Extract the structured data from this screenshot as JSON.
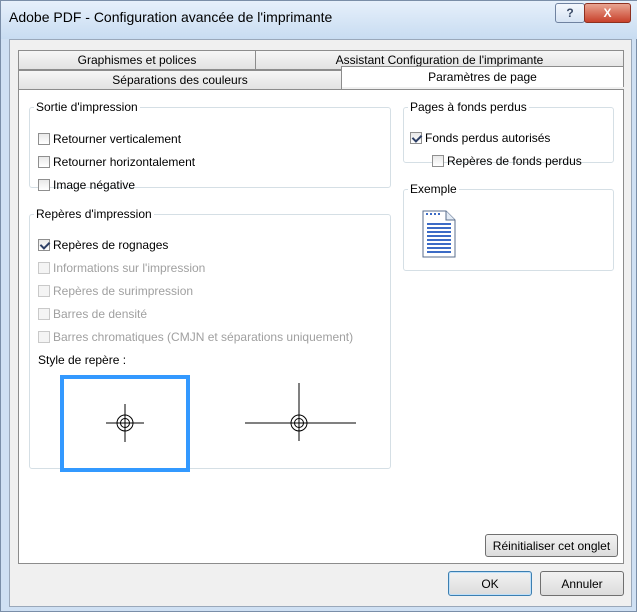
{
  "window": {
    "title": "Adobe PDF - Configuration avancée de l'imprimante",
    "help_glyph": "?",
    "close_glyph": "X"
  },
  "tabs": {
    "row1": [
      "Graphismes et polices",
      "Assistant Configuration de l'imprimante"
    ],
    "row2": [
      "Séparations des couleurs",
      "Paramètres de page"
    ],
    "active": "Paramètres de page"
  },
  "sortie": {
    "legend": "Sortie d'impression",
    "items": [
      {
        "label": "Retourner verticalement",
        "checked": false,
        "enabled": true
      },
      {
        "label": "Retourner horizontalement",
        "checked": false,
        "enabled": true
      },
      {
        "label": "Image négative",
        "checked": false,
        "enabled": true
      }
    ]
  },
  "reperes": {
    "legend": "Repères d'impression",
    "items": [
      {
        "label": "Repères de rognages",
        "checked": true,
        "enabled": true
      },
      {
        "label": "Informations sur l'impression",
        "checked": false,
        "enabled": false
      },
      {
        "label": "Repères de surimpression",
        "checked": false,
        "enabled": false
      },
      {
        "label": "Barres de densité",
        "checked": false,
        "enabled": false
      },
      {
        "label": "Barres chromatiques (CMJN et séparations uniquement)",
        "checked": false,
        "enabled": false
      }
    ],
    "style_label": "Style de repère :",
    "styles": [
      "compact",
      "long"
    ],
    "selected_style": "compact"
  },
  "fonds_perdus": {
    "legend": "Pages à fonds perdus",
    "items": [
      {
        "label": "Fonds perdus autorisés",
        "checked": true,
        "enabled": true
      },
      {
        "label": "Repères de fonds perdus",
        "checked": false,
        "enabled": true
      }
    ]
  },
  "exemple": {
    "legend": "Exemple",
    "icon": "document-icon"
  },
  "buttons": {
    "reset": "Réinitialiser cet onglet",
    "ok": "OK",
    "cancel": "Annuler"
  },
  "colors": {
    "accent": "#3399ff",
    "title_bg": "#cfe0f3",
    "close": "#c8412b"
  }
}
